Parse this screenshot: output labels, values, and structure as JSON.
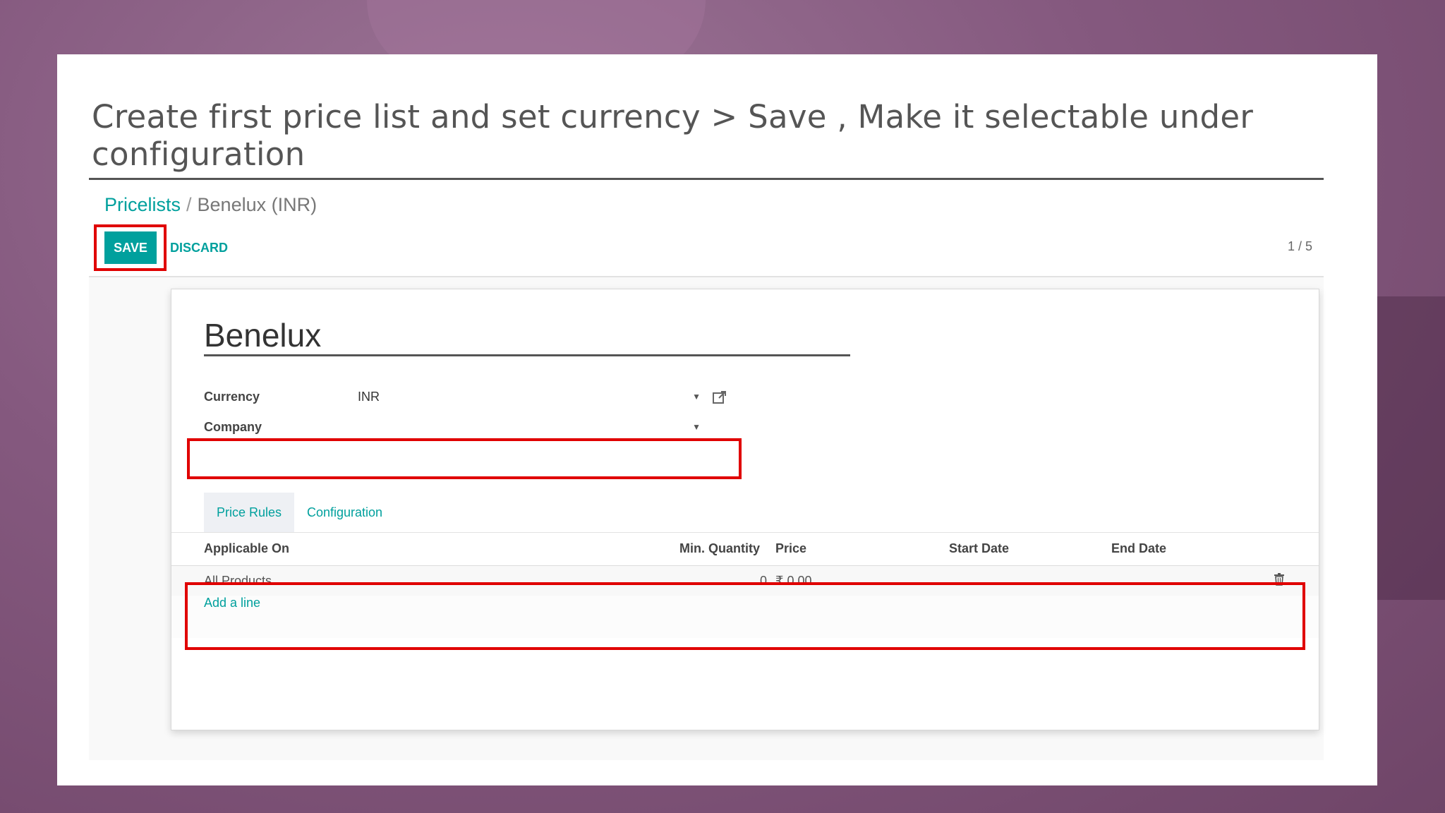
{
  "slide": {
    "title": "Create first price list and set currency > Save , Make it selectable under configuration"
  },
  "breadcrumb": {
    "root": "Pricelists",
    "separator": "/",
    "current": "Benelux (INR)"
  },
  "toolbar": {
    "save_label": "SAVE",
    "discard_label": "DISCARD",
    "pager": "1 / 5"
  },
  "form": {
    "name": "Benelux",
    "currency_label": "Currency",
    "currency_value": "INR",
    "company_label": "Company",
    "company_value": ""
  },
  "tabs": [
    {
      "label": "Price Rules",
      "active": true
    },
    {
      "label": "Configuration",
      "active": false
    }
  ],
  "table": {
    "columns": [
      "Applicable On",
      "Min. Quantity",
      "Price",
      "Start Date",
      "End Date"
    ],
    "rows": [
      {
        "applicable_on": "All Products",
        "min_quantity": "0",
        "price": "₹ 0.00",
        "start_date": "",
        "end_date": ""
      }
    ],
    "add_line": "Add a line"
  },
  "colors": {
    "accent": "#00a09d",
    "highlight": "#e00000",
    "background": "#85597f"
  },
  "icons": {
    "external_link": "external-link-icon",
    "dropdown": "chevron-down-icon",
    "delete": "trash-icon"
  }
}
